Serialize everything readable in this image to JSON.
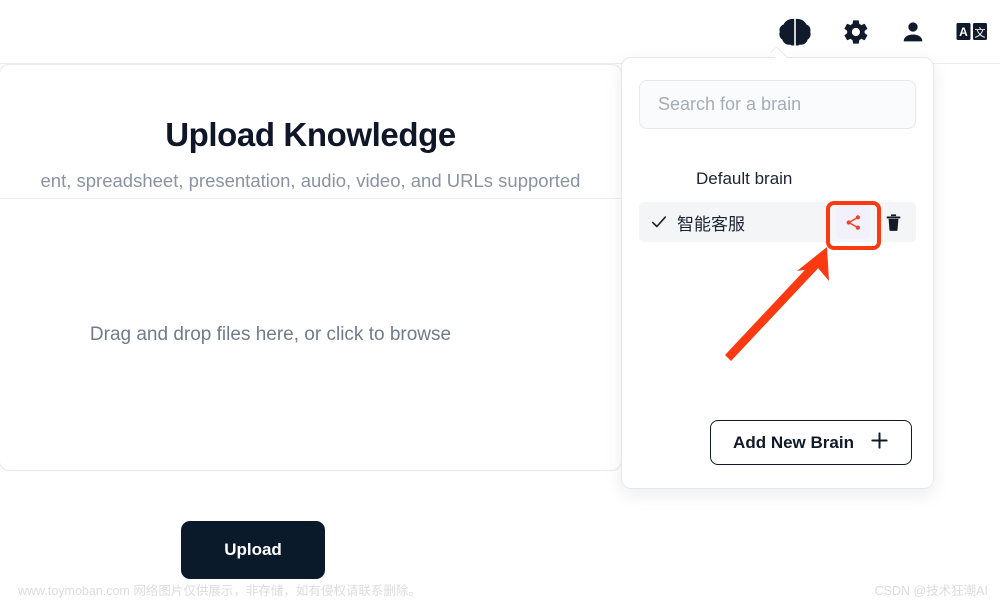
{
  "header": {
    "icons": [
      {
        "name": "brain-icon",
        "label": "Brains"
      },
      {
        "name": "gear-icon",
        "label": "Settings"
      },
      {
        "name": "user-icon",
        "label": "Account"
      },
      {
        "name": "translate-icon",
        "label": "Translate"
      }
    ],
    "translate_glyph_left": "A",
    "translate_glyph_right": "文"
  },
  "main": {
    "title": "Upload Knowledge",
    "subtitle": "ent, spreadsheet, presentation, audio, video, and URLs supported",
    "dropzone_text": "Drag and drop files here, or click to browse",
    "upload_button": "Upload"
  },
  "panel": {
    "search": {
      "placeholder": "Search for a brain",
      "value": ""
    },
    "section_label": "Default brain",
    "brains": [
      {
        "name": "智能客服",
        "selected": true,
        "check_icon": "check-icon",
        "share_icon": "share-icon",
        "delete_icon": "trash-icon"
      }
    ],
    "add_button": {
      "label": "Add New Brain",
      "icon": "plus-icon"
    }
  },
  "annotations": {
    "highlight_color": "#fb3a12",
    "arrow_color": "#fb3a12",
    "share_icon_color": "#f0412a"
  },
  "footer": {
    "left": "www.toymoban.com 网络图片仅供展示，非存储，如有侵权请联系删除。",
    "right": "CSDN @技术狂潮AI"
  }
}
